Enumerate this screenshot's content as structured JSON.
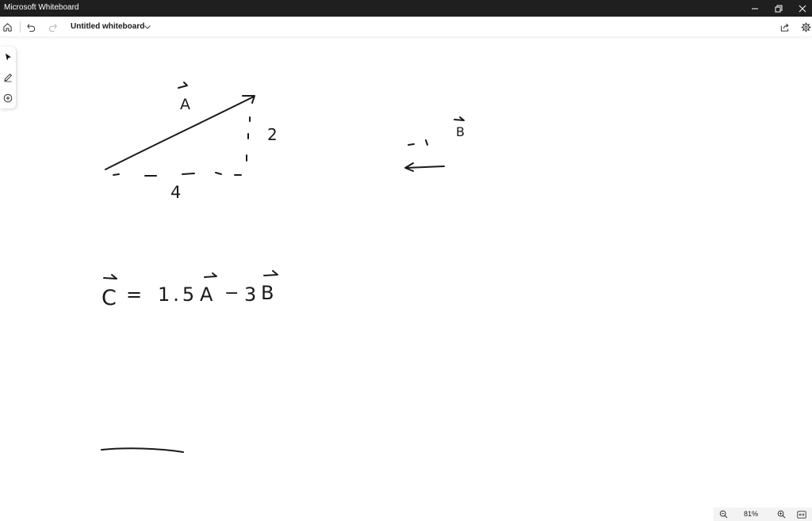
{
  "window": {
    "title": "Microsoft Whiteboard",
    "controls": [
      "minimize-icon",
      "restore-icon",
      "close-icon"
    ]
  },
  "toolbar": {
    "board_name": "Untitled whiteboard",
    "icons": [
      "home-icon",
      "undo-icon",
      "redo-icon",
      "chevron-down-icon",
      "share-icon",
      "settings-icon"
    ]
  },
  "tools": [
    "select-icon",
    "pen-icon",
    "add-icon"
  ],
  "canvas": {
    "vector_a_label": "A",
    "vector_b_label": "B",
    "horizontal_label": "4",
    "vertical_label": "2",
    "equation": {
      "c": "C",
      "equals": "=",
      "scalar_1": "1.5",
      "a": "A",
      "minus": "−",
      "scalar_2": "3",
      "b": "B"
    }
  },
  "zoom": {
    "level": "81%",
    "icons": [
      "zoom-out-icon",
      "zoom-in-icon",
      "fit-screen-icon"
    ]
  },
  "colors": {
    "titlebar": "#1f1f1f",
    "ink": "#1a1a1a",
    "canvas": "#ffffff"
  }
}
